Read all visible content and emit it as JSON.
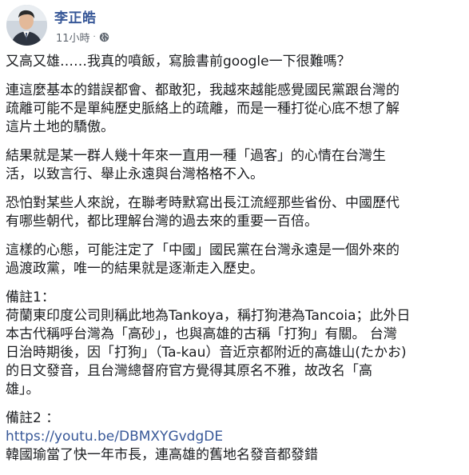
{
  "post": {
    "author": "李正皓",
    "timestamp": "11小時",
    "separator": "·",
    "privacy_icon": "globe-icon",
    "paragraphs": [
      "又高又雄……我真的噴飯，寫臉書前google一下很難嗎？",
      "連這麼基本的錯誤都會、都敢犯，我越來越能感覺國民黨跟台灣的\n疏離可能不是單純歷史脈絡上的疏離，而是一種打從心底不想了解\n這片土地的驕傲。",
      "結果就是某一群人幾十年來一直用一種「過客」的心情在台灣生\n活，以致言行、舉止永遠與台灣格格不入。",
      "恐怕對某些人來說，在聯考時默寫出長江流經那些省份、中國歷代\n有哪些朝代，都比理解台灣的過去來的重要一百倍。",
      "這樣的心態，可能注定了「中國」國民黨在台灣永遠是一個外來的\n過渡政黨，唯一的結果就是逐漸走入歷史。"
    ],
    "note1_title": "備註1：",
    "note1_body": "荷蘭東印度公司則稱此地為Tankoya，稱打狗港為Tancoia；此外日\n本古代稱呼台灣為「高砂」，也與高雄的古稱「打狗」有關。 台灣\n日治時期後，因「打狗」（Ta-kau）音近京都附近的高雄山(たかお)\n的日文發音，且台灣總督府官方覺得其原名不雅，故改名「高\n雄」。",
    "note2_title": "備註2 ：",
    "note2_link": "https://youtu.be/DBMXYGvdgDE",
    "note2_body": "韓國瑜當了快一年市長，連高雄的舊地名發音都發錯"
  },
  "colors": {
    "author_link": "#385898",
    "meta_text": "#606770",
    "body_text": "#1c1e21"
  }
}
